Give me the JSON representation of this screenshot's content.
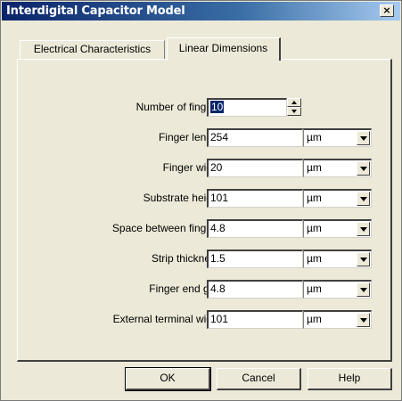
{
  "window": {
    "title": "Interdigital Capacitor Model",
    "close_symbol": "×"
  },
  "tabs": [
    {
      "label": "Electrical Characteristics",
      "active": false
    },
    {
      "label": "Linear Dimensions",
      "active": true
    }
  ],
  "fields": [
    {
      "label": "Number of fingers",
      "value": "10",
      "selected": true
    },
    {
      "label": "Finger length",
      "value": "254",
      "unit": "µm"
    },
    {
      "label": "Finger width",
      "value": "20",
      "unit": "µm"
    },
    {
      "label": "Substrate height",
      "value": "101",
      "unit": "µm"
    },
    {
      "label": "Space between fingers",
      "value": "4.8",
      "unit": "µm"
    },
    {
      "label": "Strip thickness",
      "value": "1.5",
      "unit": "µm"
    },
    {
      "label": "Finger end gap",
      "value": "4.8",
      "unit": "µm"
    },
    {
      "label": "External terminal width",
      "value": "101",
      "unit": "µm"
    }
  ],
  "buttons": {
    "ok": "OK",
    "cancel": "Cancel",
    "help": "Help"
  },
  "icons": {
    "close": "close-icon",
    "dropdown": "chevron-down-icon",
    "spinner": "up-down-spinner-icon"
  },
  "colors": {
    "titlebar_start": "#0a246a",
    "titlebar_end": "#a6caf0",
    "face": "#ece9d8",
    "selection": "#0a246a"
  }
}
